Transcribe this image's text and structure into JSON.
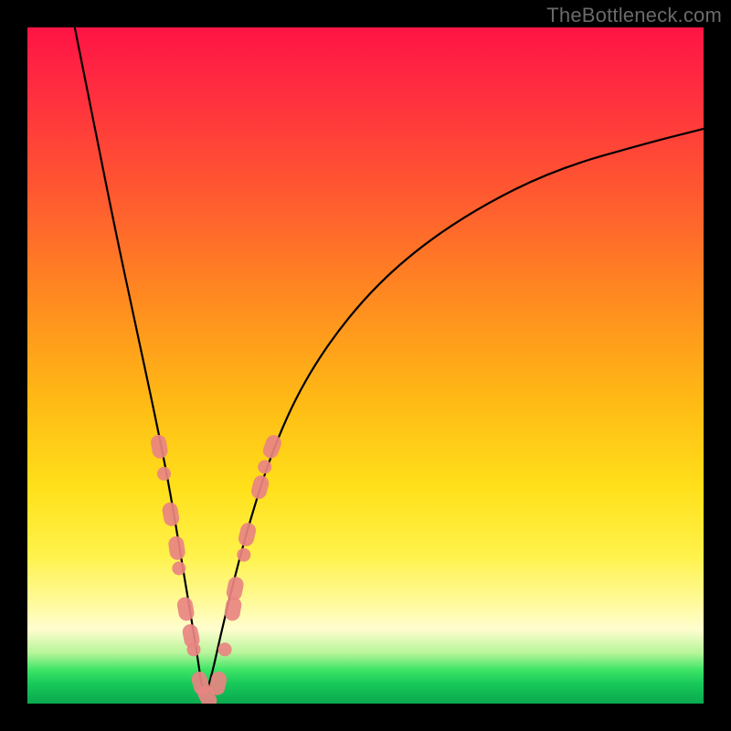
{
  "watermark": "TheBottleneck.com",
  "colors": {
    "marker": "#e98482",
    "curve": "#000000",
    "frame": "#000000"
  },
  "chart_data": {
    "type": "line",
    "title": "",
    "xlabel": "",
    "ylabel": "",
    "xlim": [
      0,
      100
    ],
    "ylim": [
      0,
      100
    ],
    "series": [
      {
        "name": "bottleneck-curve",
        "note": "V-shaped curve; y represents bottleneck magnitude, minimum near x≈26",
        "x": [
          7,
          10,
          13,
          16,
          19,
          21,
          23,
          25,
          26,
          27,
          29,
          32,
          36,
          41,
          48,
          56,
          66,
          78,
          92,
          100
        ],
        "y": [
          100,
          85,
          70,
          56,
          42,
          32,
          20,
          8,
          1,
          3,
          12,
          24,
          37,
          48,
          58,
          66,
          73,
          79,
          83,
          85
        ]
      }
    ],
    "marker_clusters": [
      {
        "name": "left-branch-markers",
        "note": "Salmon capsule/round markers along lower-left branch",
        "points": [
          {
            "x": 19.5,
            "y": 38
          },
          {
            "x": 20.2,
            "y": 34
          },
          {
            "x": 21.2,
            "y": 28
          },
          {
            "x": 22.1,
            "y": 23
          },
          {
            "x": 22.4,
            "y": 20
          },
          {
            "x": 23.4,
            "y": 14
          },
          {
            "x": 24.2,
            "y": 10
          },
          {
            "x": 24.6,
            "y": 8
          },
          {
            "x": 25.6,
            "y": 3
          },
          {
            "x": 26.6,
            "y": 1
          }
        ]
      },
      {
        "name": "right-branch-markers",
        "note": "Salmon markers along lower-right branch",
        "points": [
          {
            "x": 28.2,
            "y": 3
          },
          {
            "x": 29.2,
            "y": 8
          },
          {
            "x": 30.4,
            "y": 14
          },
          {
            "x": 30.7,
            "y": 17
          },
          {
            "x": 32.0,
            "y": 22
          },
          {
            "x": 32.5,
            "y": 25
          },
          {
            "x": 34.4,
            "y": 32
          },
          {
            "x": 35.1,
            "y": 35
          },
          {
            "x": 36.2,
            "y": 38
          }
        ]
      }
    ]
  }
}
